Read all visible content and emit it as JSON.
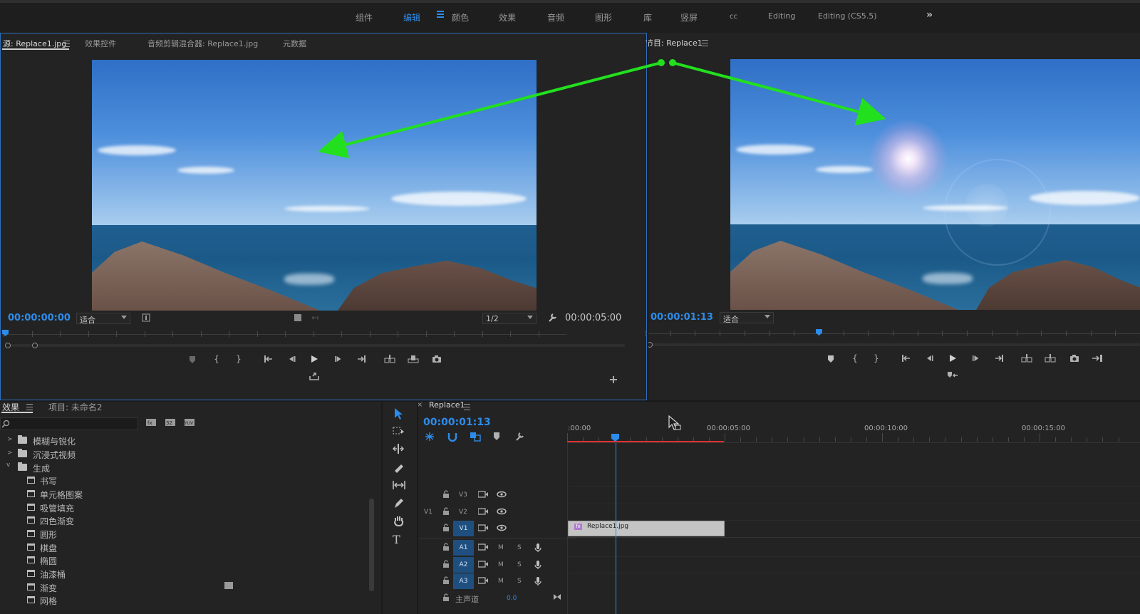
{
  "workspaces": {
    "tabs": [
      {
        "label": "组件",
        "active": false
      },
      {
        "label": "编辑",
        "active": true
      },
      {
        "label": "颜色",
        "active": false
      },
      {
        "label": "效果",
        "active": false
      },
      {
        "label": "音频",
        "active": false
      },
      {
        "label": "图形",
        "active": false
      },
      {
        "label": "库",
        "active": false
      },
      {
        "label": "竖屏",
        "active": false
      },
      {
        "label": "cc",
        "active": false
      },
      {
        "label": "Editing",
        "active": false
      },
      {
        "label": "Editing (CS5.5)",
        "active": false
      }
    ],
    "more": "»"
  },
  "source_monitor": {
    "tabs": [
      "源: Replace1.jpg",
      "效果控件",
      "音频剪辑混合器: Replace1.jpg",
      "元数据"
    ],
    "timecode_in": "00:00:00:00",
    "zoom": "适合",
    "resolution": "1/2",
    "duration": "00:00:05:00",
    "playhead_fraction": 0.0
  },
  "program_monitor": {
    "tab": "节目: Replace1",
    "timecode": "00:00:01:13",
    "zoom": "适合",
    "playhead_fraction": 0.35
  },
  "effects_panel": {
    "tabs": [
      "效果",
      "项目: 未命名2"
    ],
    "search_placeholder": "",
    "items": [
      {
        "label": "模糊与锐化",
        "type": "folder",
        "expanded": false,
        "level": 0
      },
      {
        "label": "沉浸式视频",
        "type": "folder",
        "expanded": false,
        "level": 0
      },
      {
        "label": "生成",
        "type": "folder",
        "expanded": true,
        "level": 0
      },
      {
        "label": "书写",
        "type": "effect",
        "level": 1
      },
      {
        "label": "单元格图案",
        "type": "effect",
        "level": 1
      },
      {
        "label": "吸管填充",
        "type": "effect",
        "level": 1
      },
      {
        "label": "四色渐变",
        "type": "effect",
        "level": 1
      },
      {
        "label": "圆形",
        "type": "effect",
        "level": 1
      },
      {
        "label": "棋盘",
        "type": "effect",
        "level": 1
      },
      {
        "label": "椭圆",
        "type": "effect",
        "level": 1
      },
      {
        "label": "油漆桶",
        "type": "effect",
        "level": 1
      },
      {
        "label": "渐变",
        "type": "effect",
        "level": 1
      },
      {
        "label": "网格",
        "type": "effect",
        "level": 1
      }
    ]
  },
  "timeline": {
    "sequence_tab": "Replace1",
    "close": "×",
    "timecode": "00:00:01:13",
    "ruler_labels": [
      ":00:00",
      "00:00:05:00",
      "00:00:10:00",
      "00:00:15:00"
    ],
    "tracks": {
      "video": [
        {
          "name": "V3",
          "targeted": false,
          "src": ""
        },
        {
          "name": "V2",
          "targeted": false,
          "src": "V1"
        },
        {
          "name": "V1",
          "targeted": true,
          "src": ""
        }
      ],
      "audio": [
        {
          "name": "A1",
          "m": "M",
          "s": "S"
        },
        {
          "name": "A2",
          "m": "M",
          "s": "S"
        },
        {
          "name": "A3",
          "m": "M",
          "s": "S"
        }
      ],
      "master": {
        "label": "主声道",
        "value": "0.0"
      }
    },
    "clip": {
      "name": "Replace1.jpg",
      "fx_badge": "fx"
    }
  },
  "colors": {
    "accent": "#2d8ceb",
    "arrow": "#22e01e",
    "work_area": "#e03030"
  }
}
